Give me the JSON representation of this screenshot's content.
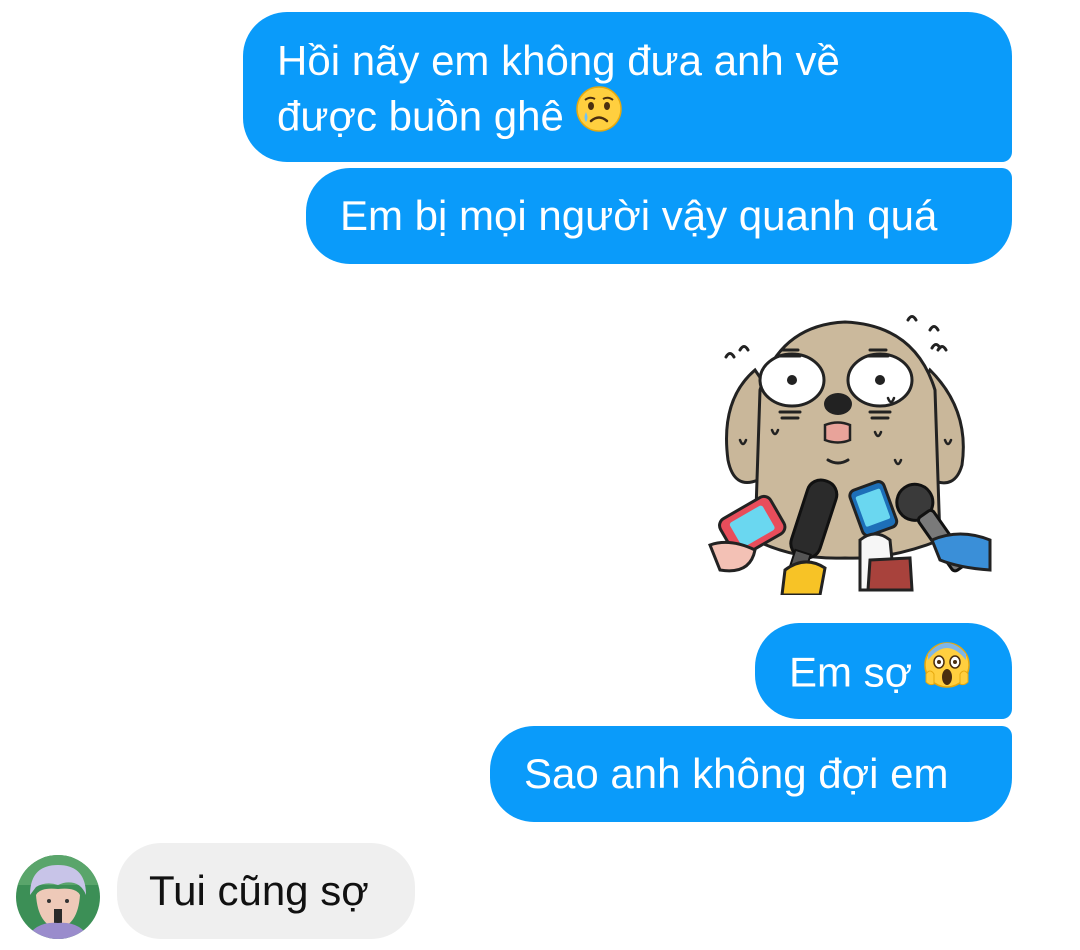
{
  "messages": [
    {
      "from": "me",
      "text_line1": "Hồi nãy em không đưa anh về",
      "text_line2": "được buồn ghê",
      "emoji": "crying-face-emoji"
    },
    {
      "from": "me",
      "text": "Em bị mọi người vậy quanh quá"
    },
    {
      "from": "me",
      "type": "sticker",
      "sticker": "nervous-dog-with-microphones-sticker"
    },
    {
      "from": "me",
      "text": "Em sợ",
      "emoji": "screaming-face-emoji"
    },
    {
      "from": "me",
      "text": "Sao anh không đợi em"
    },
    {
      "from": "them",
      "text": "Tui cũng sợ",
      "avatar": "user-avatar"
    }
  ],
  "colors": {
    "outgoing_bubble": "#0a9bfa",
    "incoming_bubble": "#efefef",
    "outgoing_text": "#ffffff",
    "incoming_text": "#111111"
  }
}
